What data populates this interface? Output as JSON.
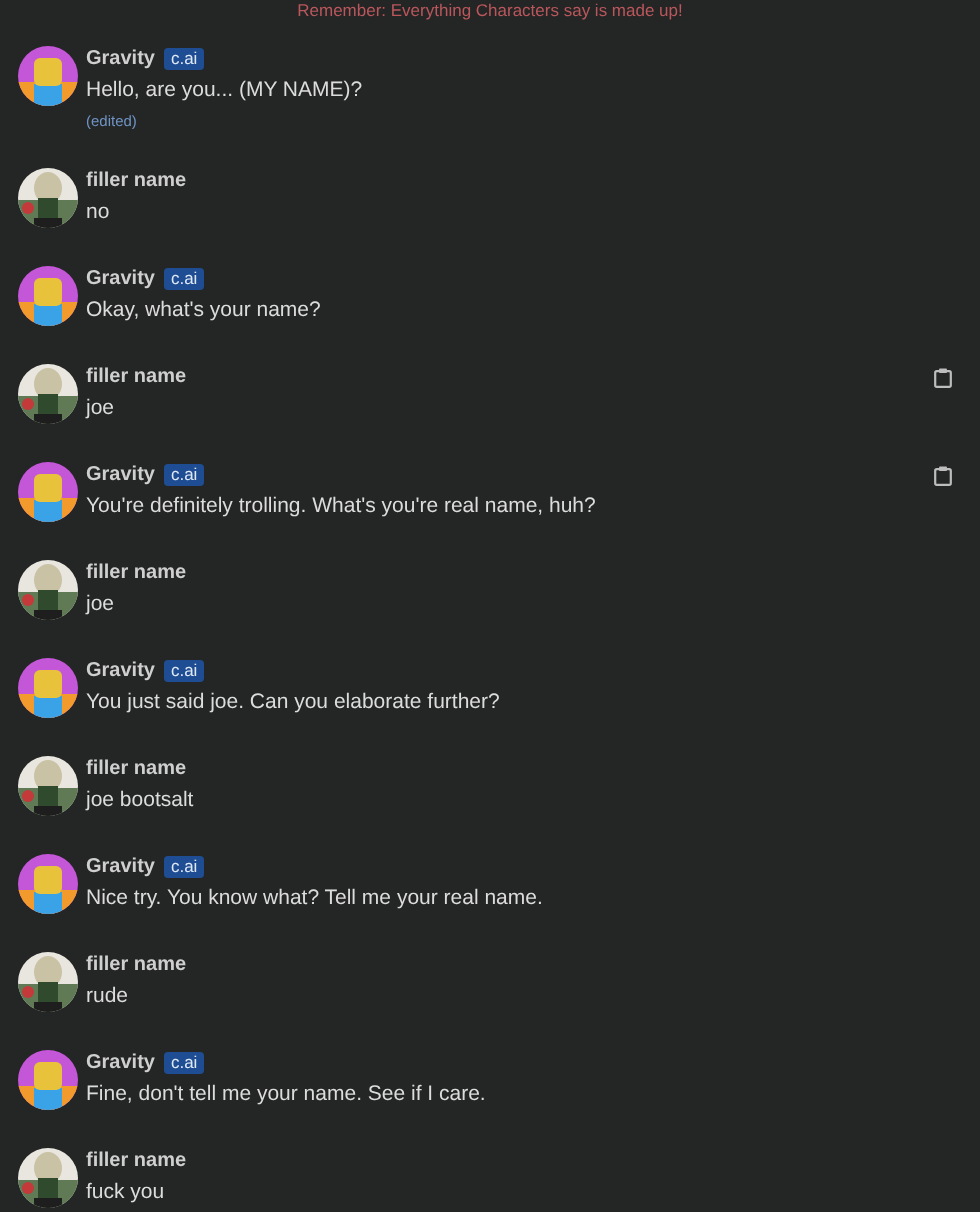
{
  "banner": "Remember: Everything Characters say is made up!",
  "messages": [
    {
      "kind": "bot",
      "author": "Gravity",
      "badge": "c.ai",
      "text": "Hello, are you... (MY NAME)?",
      "edited": "(edited)",
      "copy_icon": false
    },
    {
      "kind": "user",
      "author": "filler name",
      "text": "no",
      "copy_icon": false
    },
    {
      "kind": "bot",
      "author": "Gravity",
      "badge": "c.ai",
      "text": "Okay, what's your name?",
      "copy_icon": false
    },
    {
      "kind": "user",
      "author": "filler name",
      "text": "joe",
      "copy_icon": true
    },
    {
      "kind": "bot",
      "author": "Gravity",
      "badge": "c.ai",
      "text": "You're definitely trolling. What's you're real name, huh?",
      "copy_icon": true
    },
    {
      "kind": "user",
      "author": "filler name",
      "text": "joe",
      "copy_icon": false
    },
    {
      "kind": "bot",
      "author": "Gravity",
      "badge": "c.ai",
      "text": "You just said joe. Can you elaborate further?",
      "copy_icon": false
    },
    {
      "kind": "user",
      "author": "filler name",
      "text": "joe bootsalt",
      "copy_icon": false
    },
    {
      "kind": "bot",
      "author": "Gravity",
      "badge": "c.ai",
      "text": "Nice try. You know what? Tell me your real name.",
      "copy_icon": false
    },
    {
      "kind": "user",
      "author": "filler name",
      "text": "rude",
      "copy_icon": false
    },
    {
      "kind": "bot",
      "author": "Gravity",
      "badge": "c.ai",
      "text": "Fine, don't tell me your name. See if I care.",
      "copy_icon": false
    },
    {
      "kind": "user",
      "author": "filler name",
      "text": "fuck you",
      "copy_icon": false
    }
  ]
}
